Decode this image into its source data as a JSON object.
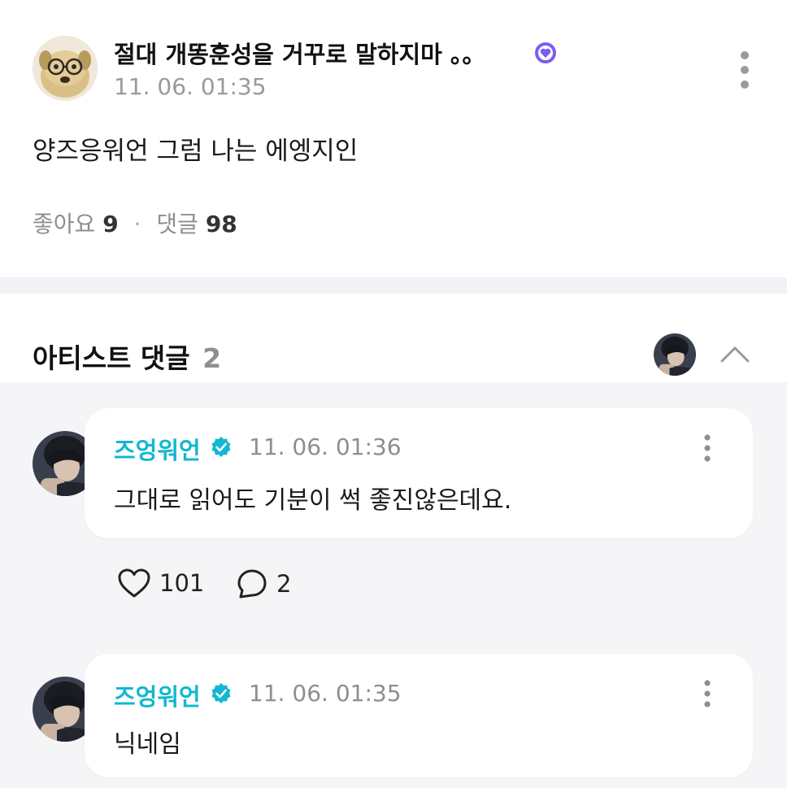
{
  "post": {
    "author": "절대 개똥훈성을 거꾸로 말하지마 。。",
    "timestamp": "11. 06. 01:35",
    "body": "양즈응워언 그럼 나는 에엥지인",
    "stats": {
      "likes_label": "좋아요",
      "likes_count": "9",
      "separator": "·",
      "comments_label": "댓글",
      "comments_count": "98"
    }
  },
  "artist_comments": {
    "title": "아티스트 댓글",
    "count": "2"
  },
  "comments": [
    {
      "author": "즈엉워언",
      "timestamp": "11. 06. 01:36",
      "text": "그대로 읽어도 기분이 썩 좋진않은데요.",
      "likes": "101",
      "replies": "2"
    },
    {
      "author": "즈엉워언",
      "timestamp": "11. 06. 01:35",
      "text": "닉네임"
    }
  ],
  "colors": {
    "artist_name": "#11b8cf",
    "verified_badge": "#11b8cf",
    "fan_badge": "#7b5cf5",
    "divider": "#f2f2f6",
    "comments_bg": "#f5f5f8"
  },
  "icons": {
    "more": "vertical-ellipsis-icon",
    "collapse": "chevron-up-icon",
    "like": "heart-outline-icon",
    "reply": "speech-bubble-icon",
    "verified": "verified-check-icon",
    "fan_badge": "heart-badge-icon"
  }
}
